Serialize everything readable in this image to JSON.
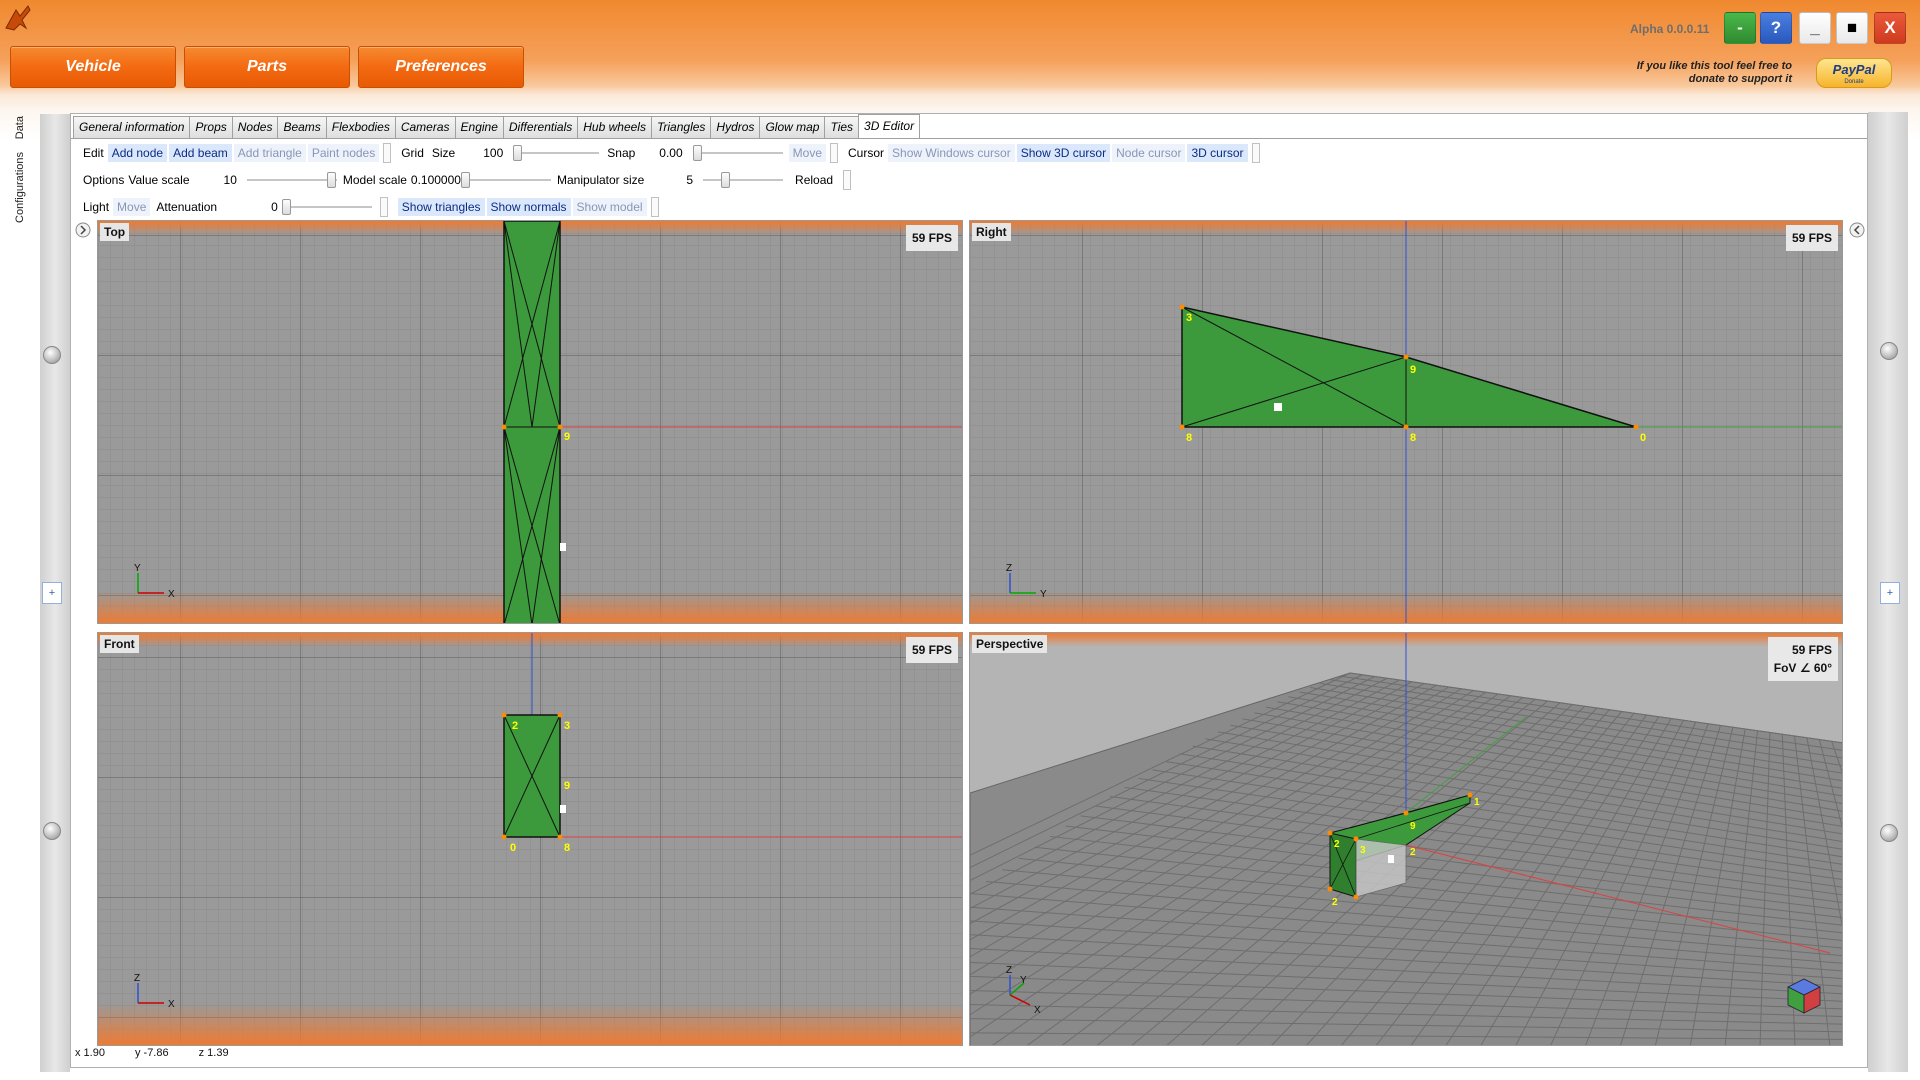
{
  "window": {
    "version": "Alpha 0.0.0.11",
    "buttons": {
      "green": "-",
      "help": "?",
      "minimize": "_",
      "maximize": "■",
      "close": "X"
    }
  },
  "main_buttons": [
    "Vehicle",
    "Parts",
    "Preferences"
  ],
  "donate": {
    "text": "If you like this tool feel free to donate to support it",
    "paypal": "PayPal",
    "paypal_sub": "Donate"
  },
  "side_tabs": [
    "Data",
    "Configurations"
  ],
  "tabs": [
    "General information",
    "Props",
    "Nodes",
    "Beams",
    "Flexbodies",
    "Cameras",
    "Engine",
    "Differentials",
    "Hub wheels",
    "Triangles",
    "Hydros",
    "Glow map",
    "Ties",
    "3D Editor"
  ],
  "toolbar": {
    "edit_label": "Edit",
    "add_node": "Add node",
    "add_beam": "Add beam",
    "add_triangle": "Add triangle",
    "paint_nodes": "Paint nodes",
    "grid_label": "Grid",
    "size_label": "Size",
    "size_value": "100",
    "snap_label": "Snap",
    "snap_value": "0.00",
    "move": "Move",
    "cursor_label": "Cursor",
    "show_windows_cursor": "Show Windows cursor",
    "show_3d_cursor": "Show 3D cursor",
    "node_cursor": "Node cursor",
    "cursor_3d": "3D cursor",
    "options_label": "Options",
    "value_scale_label": "Value scale",
    "value_scale_value": "10",
    "model_scale_label": "Model scale",
    "model_scale_value": "0.100000",
    "manipulator_label": "Manipulator size",
    "manipulator_value": "5",
    "reload": "Reload",
    "light_label": "Light",
    "light_move": "Move",
    "attenuation_label": "Attenuation",
    "attenuation_value": "0",
    "show_triangles": "Show triangles",
    "show_normals": "Show normals",
    "show_model": "Show model"
  },
  "viewports": {
    "top": {
      "label": "Top",
      "fps": "59 FPS",
      "axis_v": "Y",
      "axis_h": "X"
    },
    "right": {
      "label": "Right",
      "fps": "59 FPS",
      "axis_v": "Z",
      "axis_h": "Y"
    },
    "front": {
      "label": "Front",
      "fps": "59 FPS",
      "axis_v": "Z",
      "axis_h": "X"
    },
    "perspective": {
      "label": "Perspective",
      "fps": "59 FPS",
      "fov": "FoV ∠ 60°",
      "axis_v": "Z",
      "axis_d": "Y",
      "axis_h": "X"
    }
  },
  "node_labels": {
    "top": [
      "9"
    ],
    "right": [
      "3",
      "9",
      "8",
      "8",
      "0"
    ],
    "front": [
      "2",
      "3",
      "9",
      "0",
      "8"
    ],
    "perspective": [
      "2",
      "3",
      "9",
      "2",
      "2",
      "1"
    ]
  },
  "status": {
    "x": "x 1.90",
    "y": "y -7.86",
    "z": "z 1.39"
  },
  "colors": {
    "accent": "#f36a12",
    "mesh": "#3a9a3a",
    "grid_bg": "#999999",
    "node": "#ff8c00",
    "label": "#ffff00"
  }
}
